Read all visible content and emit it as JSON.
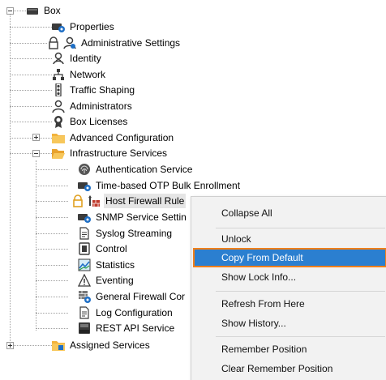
{
  "tree": {
    "root_label": "Box",
    "items": [
      {
        "label": "Properties",
        "icon": "properties-icon"
      },
      {
        "label": "Administrative Settings",
        "icon": "admin-settings-icon"
      },
      {
        "label": "Identity",
        "icon": "identity-icon"
      },
      {
        "label": "Network",
        "icon": "network-icon"
      },
      {
        "label": "Traffic Shaping",
        "icon": "traffic-light-icon"
      },
      {
        "label": "Administrators",
        "icon": "user-icon"
      },
      {
        "label": "Box Licenses",
        "icon": "license-icon"
      },
      {
        "label": "Advanced Configuration",
        "icon": "folder-icon"
      },
      {
        "label": "Infrastructure Services",
        "icon": "folder-open-icon"
      },
      {
        "label": "Assigned Services",
        "icon": "folder-icon"
      }
    ],
    "infra_children": [
      {
        "label": "Authentication Service",
        "icon": "fingerprint-icon"
      },
      {
        "label": "Time-based OTP Bulk Enrollment",
        "icon": "box-gear-icon"
      },
      {
        "label": "Host Firewall Rule",
        "icon": "firewall-icon"
      },
      {
        "label": "SNMP Service Settin",
        "icon": "box-gear-icon"
      },
      {
        "label": "Syslog Streaming",
        "icon": "document-icon"
      },
      {
        "label": "Control",
        "icon": "control-icon"
      },
      {
        "label": "Statistics",
        "icon": "statistics-icon"
      },
      {
        "label": "Eventing",
        "icon": "warning-icon"
      },
      {
        "label": "General Firewall Cor",
        "icon": "firewall-gear-icon"
      },
      {
        "label": "Log Configuration",
        "icon": "document-icon"
      },
      {
        "label": "REST API Service",
        "icon": "rest-icon"
      }
    ]
  },
  "context_menu": {
    "items": [
      {
        "label": "Collapse All"
      },
      {
        "label": "Unlock"
      },
      {
        "label": "Copy From Default",
        "highlighted": true
      },
      {
        "label": "Show Lock Info..."
      },
      {
        "label": "Refresh From Here"
      },
      {
        "label": "Show History..."
      },
      {
        "label": "Remember Position"
      },
      {
        "label": "Clear Remember Position"
      }
    ]
  },
  "colors": {
    "highlight": "#2b7fd0",
    "highlight_border": "#f07f1a",
    "folder": "#f2b33d",
    "lock": "#e0a020"
  }
}
